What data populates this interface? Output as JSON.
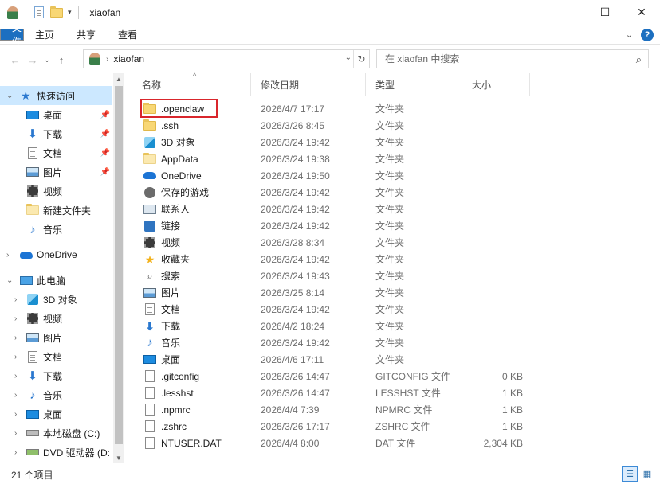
{
  "window": {
    "title": "xiaofan"
  },
  "ribbon": {
    "tabs": [
      "文件",
      "主页",
      "共享",
      "查看"
    ],
    "help": "?"
  },
  "address": {
    "path": "xiaofan"
  },
  "search": {
    "placeholder": "在 xiaofan 中搜索"
  },
  "nav": {
    "quick_access": "快速访问",
    "quick_items": [
      "桌面",
      "下载",
      "文档",
      "图片",
      "视频",
      "新建文件夹",
      "音乐"
    ],
    "onedrive": "OneDrive",
    "this_pc": "此电脑",
    "pc_items": [
      "3D 对象",
      "视频",
      "图片",
      "文档",
      "下载",
      "音乐",
      "桌面",
      "本地磁盘 (C:)",
      "DVD 驱动器 (D:"
    ]
  },
  "columns": {
    "name": "名称",
    "date": "修改日期",
    "type": "类型",
    "size": "大小"
  },
  "files": [
    {
      "name": ".openclaw",
      "date": "2026/4/7 17:17",
      "type": "文件夹",
      "size": "",
      "icon": "folder-icon"
    },
    {
      "name": ".ssh",
      "date": "2026/3/26 8:45",
      "type": "文件夹",
      "size": "",
      "icon": "folder-icon"
    },
    {
      "name": "3D 对象",
      "date": "2026/3/24 19:42",
      "type": "文件夹",
      "size": "",
      "icon": "3d-objects-icon"
    },
    {
      "name": "AppData",
      "date": "2026/3/24 19:38",
      "type": "文件夹",
      "size": "",
      "icon": "folder-icon"
    },
    {
      "name": "OneDrive",
      "date": "2026/3/24 19:50",
      "type": "文件夹",
      "size": "",
      "icon": "onedrive-icon"
    },
    {
      "name": "保存的游戏",
      "date": "2026/3/24 19:42",
      "type": "文件夹",
      "size": "",
      "icon": "saved-games-icon"
    },
    {
      "name": "联系人",
      "date": "2026/3/24 19:42",
      "type": "文件夹",
      "size": "",
      "icon": "contacts-icon"
    },
    {
      "name": "链接",
      "date": "2026/3/24 19:42",
      "type": "文件夹",
      "size": "",
      "icon": "links-icon"
    },
    {
      "name": "视频",
      "date": "2026/3/28 8:34",
      "type": "文件夹",
      "size": "",
      "icon": "videos-icon"
    },
    {
      "name": "收藏夹",
      "date": "2026/3/24 19:42",
      "type": "文件夹",
      "size": "",
      "icon": "favorites-icon"
    },
    {
      "name": "搜索",
      "date": "2026/3/24 19:43",
      "type": "文件夹",
      "size": "",
      "icon": "searches-icon"
    },
    {
      "name": "图片",
      "date": "2026/3/25 8:14",
      "type": "文件夹",
      "size": "",
      "icon": "pictures-icon"
    },
    {
      "name": "文档",
      "date": "2026/3/24 19:42",
      "type": "文件夹",
      "size": "",
      "icon": "documents-icon"
    },
    {
      "name": "下载",
      "date": "2026/4/2 18:24",
      "type": "文件夹",
      "size": "",
      "icon": "downloads-icon"
    },
    {
      "name": "音乐",
      "date": "2026/3/24 19:42",
      "type": "文件夹",
      "size": "",
      "icon": "music-icon"
    },
    {
      "name": "桌面",
      "date": "2026/4/6 17:11",
      "type": "文件夹",
      "size": "",
      "icon": "desktop-icon"
    },
    {
      "name": ".gitconfig",
      "date": "2026/3/26 14:47",
      "type": "GITCONFIG 文件",
      "size": "0 KB",
      "icon": "file-icon"
    },
    {
      "name": ".lesshst",
      "date": "2026/3/26 14:47",
      "type": "LESSHST 文件",
      "size": "1 KB",
      "icon": "file-icon"
    },
    {
      "name": ".npmrc",
      "date": "2026/4/4 7:39",
      "type": "NPMRC 文件",
      "size": "1 KB",
      "icon": "file-icon"
    },
    {
      "name": ".zshrc",
      "date": "2026/3/26 17:17",
      "type": "ZSHRC 文件",
      "size": "1 KB",
      "icon": "file-icon"
    },
    {
      "name": "NTUSER.DAT",
      "date": "2026/4/4 8:00",
      "type": "DAT 文件",
      "size": "2,304 KB",
      "icon": "file-icon"
    }
  ],
  "status": {
    "count": "21 个项目"
  },
  "colors": {
    "accent": "#1c6fc0",
    "selection": "#cce8ff",
    "highlight_box": "#d9262c"
  }
}
